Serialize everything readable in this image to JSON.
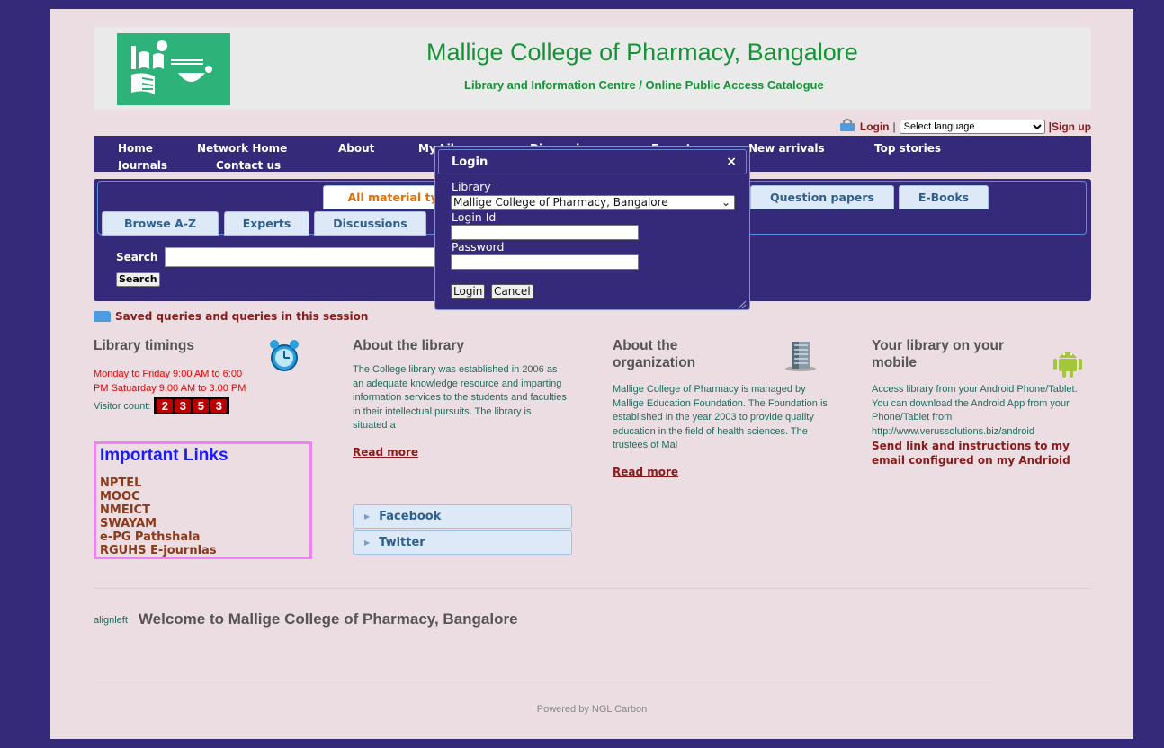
{
  "header": {
    "title": "Mallige College of Pharmacy, Bangalore",
    "subtitle": "Library and Information Centre / Online Public Access Catalogue"
  },
  "toprow": {
    "login": "Login",
    "separator": "|",
    "language": "Select language",
    "signup": "|Sign up"
  },
  "nav": {
    "items": [
      "Home",
      "Network Home",
      "About",
      "My Library",
      "Discussions",
      "Experts",
      "New arrivals",
      "Top stories",
      "Journals",
      "Contact us"
    ]
  },
  "tabs": {
    "row1": [
      "All material types",
      "Question papers",
      "E-Books"
    ],
    "row2": [
      "Browse A-Z",
      "Experts",
      "Discussions"
    ]
  },
  "search": {
    "label": "Search",
    "button": "Search",
    "saved": "Saved queries and queries in this session"
  },
  "timings": {
    "title": "Library timings",
    "text": "Monday to Friday 9:00 AM to 6:00 PM Satuarday 9.00 AM to 3.00 PM",
    "visitor_label": "Visitor count:",
    "visitor_digits": [
      "2",
      "3",
      "5",
      "3"
    ]
  },
  "important_links": {
    "title": "Important Links",
    "items": [
      "NPTEL",
      "MOOC",
      "NMEICT",
      "SWAYAM",
      "e-PG Pathshala",
      "RGUHS E-journlas"
    ]
  },
  "about_library": {
    "title": "About the library",
    "text": "The College library was established in 2006 as an adequate knowledge resource and imparting information services to the students and faculties in their intellectual pursuits. The library is situated a",
    "read_more": "Read more"
  },
  "social": {
    "facebook": "Facebook",
    "twitter": "Twitter"
  },
  "about_org": {
    "title": "About the organization",
    "text": "Mallige College of Pharmacy is managed by Mallige Education Foundation. The Foundation is established in the year 2003 to provide quality education in the field of health sciences. The trustees of Mal",
    "read_more": "Read more"
  },
  "mobile": {
    "title": "Your library on your mobile",
    "text": "Access library from your Android Phone/Tablet. You can download the Android App from your Phone/Tablet from http://www.verussolutions.biz/android",
    "bold_text": "Send link and instructions to my email configured on my Andrioid"
  },
  "welcome": {
    "alignleft": "alignleft",
    "text": "Welcome to Mallige College of Pharmacy, Bangalore"
  },
  "footer": {
    "text": "Powered by NGL Carbon"
  },
  "modal": {
    "title": "Login",
    "close": "×",
    "library_label": "Library",
    "library_value": "Mallige College of Pharmacy, Bangalore",
    "login_id_label": "Login Id",
    "password_label": "Password",
    "login_button": "Login",
    "cancel_button": "Cancel"
  },
  "colors": {
    "brand_purple": "#352a7a",
    "title_green": "#149436",
    "link_maroon": "#8b1a1a",
    "tab_active_orange": "#e46f00"
  }
}
